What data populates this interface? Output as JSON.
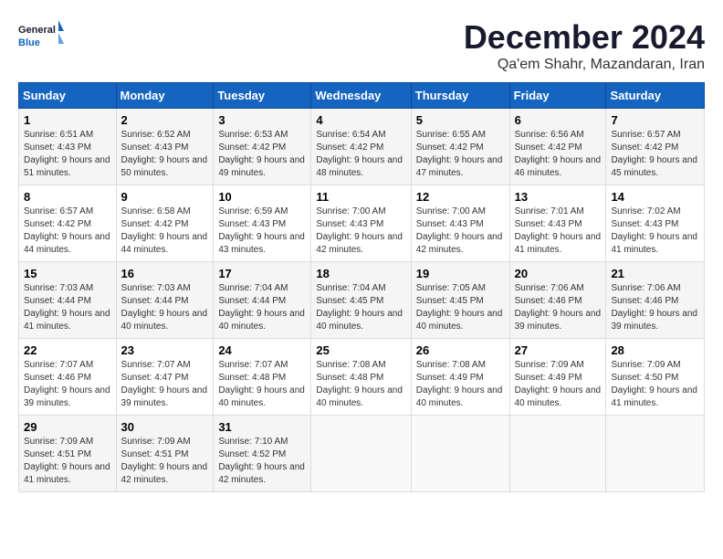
{
  "logo": {
    "line1": "General",
    "line2": "Blue"
  },
  "title": "December 2024",
  "subtitle": "Qa'em Shahr, Mazandaran, Iran",
  "weekdays": [
    "Sunday",
    "Monday",
    "Tuesday",
    "Wednesday",
    "Thursday",
    "Friday",
    "Saturday"
  ],
  "weeks": [
    [
      {
        "day": 1,
        "sunrise": "6:51 AM",
        "sunset": "4:43 PM",
        "daylight": "9 hours and 51 minutes."
      },
      {
        "day": 2,
        "sunrise": "6:52 AM",
        "sunset": "4:43 PM",
        "daylight": "9 hours and 50 minutes."
      },
      {
        "day": 3,
        "sunrise": "6:53 AM",
        "sunset": "4:42 PM",
        "daylight": "9 hours and 49 minutes."
      },
      {
        "day": 4,
        "sunrise": "6:54 AM",
        "sunset": "4:42 PM",
        "daylight": "9 hours and 48 minutes."
      },
      {
        "day": 5,
        "sunrise": "6:55 AM",
        "sunset": "4:42 PM",
        "daylight": "9 hours and 47 minutes."
      },
      {
        "day": 6,
        "sunrise": "6:56 AM",
        "sunset": "4:42 PM",
        "daylight": "9 hours and 46 minutes."
      },
      {
        "day": 7,
        "sunrise": "6:57 AM",
        "sunset": "4:42 PM",
        "daylight": "9 hours and 45 minutes."
      }
    ],
    [
      {
        "day": 8,
        "sunrise": "6:57 AM",
        "sunset": "4:42 PM",
        "daylight": "9 hours and 44 minutes."
      },
      {
        "day": 9,
        "sunrise": "6:58 AM",
        "sunset": "4:42 PM",
        "daylight": "9 hours and 44 minutes."
      },
      {
        "day": 10,
        "sunrise": "6:59 AM",
        "sunset": "4:43 PM",
        "daylight": "9 hours and 43 minutes."
      },
      {
        "day": 11,
        "sunrise": "7:00 AM",
        "sunset": "4:43 PM",
        "daylight": "9 hours and 42 minutes."
      },
      {
        "day": 12,
        "sunrise": "7:00 AM",
        "sunset": "4:43 PM",
        "daylight": "9 hours and 42 minutes."
      },
      {
        "day": 13,
        "sunrise": "7:01 AM",
        "sunset": "4:43 PM",
        "daylight": "9 hours and 41 minutes."
      },
      {
        "day": 14,
        "sunrise": "7:02 AM",
        "sunset": "4:43 PM",
        "daylight": "9 hours and 41 minutes."
      }
    ],
    [
      {
        "day": 15,
        "sunrise": "7:03 AM",
        "sunset": "4:44 PM",
        "daylight": "9 hours and 41 minutes."
      },
      {
        "day": 16,
        "sunrise": "7:03 AM",
        "sunset": "4:44 PM",
        "daylight": "9 hours and 40 minutes."
      },
      {
        "day": 17,
        "sunrise": "7:04 AM",
        "sunset": "4:44 PM",
        "daylight": "9 hours and 40 minutes."
      },
      {
        "day": 18,
        "sunrise": "7:04 AM",
        "sunset": "4:45 PM",
        "daylight": "9 hours and 40 minutes."
      },
      {
        "day": 19,
        "sunrise": "7:05 AM",
        "sunset": "4:45 PM",
        "daylight": "9 hours and 40 minutes."
      },
      {
        "day": 20,
        "sunrise": "7:06 AM",
        "sunset": "4:46 PM",
        "daylight": "9 hours and 39 minutes."
      },
      {
        "day": 21,
        "sunrise": "7:06 AM",
        "sunset": "4:46 PM",
        "daylight": "9 hours and 39 minutes."
      }
    ],
    [
      {
        "day": 22,
        "sunrise": "7:07 AM",
        "sunset": "4:46 PM",
        "daylight": "9 hours and 39 minutes."
      },
      {
        "day": 23,
        "sunrise": "7:07 AM",
        "sunset": "4:47 PM",
        "daylight": "9 hours and 39 minutes."
      },
      {
        "day": 24,
        "sunrise": "7:07 AM",
        "sunset": "4:48 PM",
        "daylight": "9 hours and 40 minutes."
      },
      {
        "day": 25,
        "sunrise": "7:08 AM",
        "sunset": "4:48 PM",
        "daylight": "9 hours and 40 minutes."
      },
      {
        "day": 26,
        "sunrise": "7:08 AM",
        "sunset": "4:49 PM",
        "daylight": "9 hours and 40 minutes."
      },
      {
        "day": 27,
        "sunrise": "7:09 AM",
        "sunset": "4:49 PM",
        "daylight": "9 hours and 40 minutes."
      },
      {
        "day": 28,
        "sunrise": "7:09 AM",
        "sunset": "4:50 PM",
        "daylight": "9 hours and 41 minutes."
      }
    ],
    [
      {
        "day": 29,
        "sunrise": "7:09 AM",
        "sunset": "4:51 PM",
        "daylight": "9 hours and 41 minutes."
      },
      {
        "day": 30,
        "sunrise": "7:09 AM",
        "sunset": "4:51 PM",
        "daylight": "9 hours and 42 minutes."
      },
      {
        "day": 31,
        "sunrise": "7:10 AM",
        "sunset": "4:52 PM",
        "daylight": "9 hours and 42 minutes."
      },
      null,
      null,
      null,
      null
    ]
  ]
}
